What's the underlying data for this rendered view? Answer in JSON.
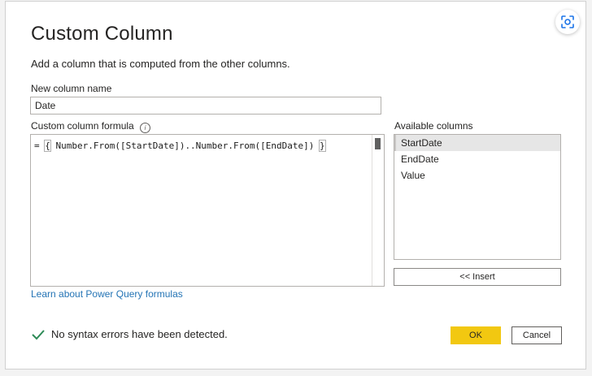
{
  "dialog": {
    "title": "Custom Column",
    "subtitle": "Add a column that is computed from the other columns."
  },
  "new_column": {
    "label": "New column name",
    "value": "Date"
  },
  "formula": {
    "label": "Custom column formula",
    "prefix": "= ",
    "open_brace": "{",
    "body": " Number.From([StartDate])..Number.From([EndDate]) ",
    "close_brace": "}"
  },
  "available": {
    "label": "Available columns",
    "items": [
      "StartDate",
      "EndDate",
      "Value"
    ],
    "selected": "StartDate"
  },
  "buttons": {
    "insert": "<< Insert",
    "ok": "OK",
    "cancel": "Cancel"
  },
  "link": {
    "text": "Learn about Power Query formulas"
  },
  "status": {
    "text": "No syntax errors have been detected."
  },
  "colors": {
    "ok_button": "#f2c811",
    "link": "#2474b5",
    "check": "#2e8b57"
  },
  "icons": {
    "lens": "visual-search-icon",
    "info": "info-icon",
    "check": "checkmark-icon"
  }
}
